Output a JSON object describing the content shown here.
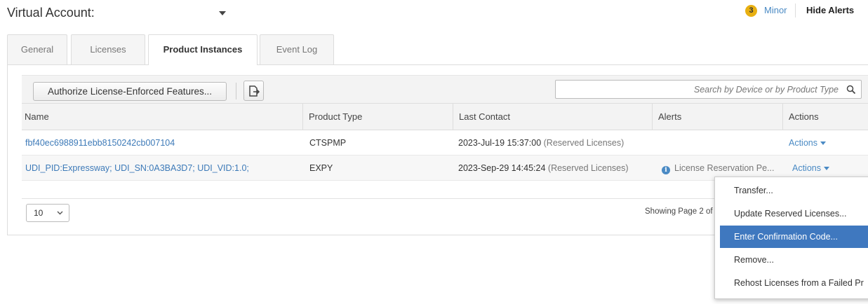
{
  "header": {
    "title": "Virtual Account:",
    "alert_count": "3",
    "alert_level": "Minor",
    "hide_alerts": "Hide Alerts"
  },
  "tabs": [
    {
      "label": "General",
      "active": false
    },
    {
      "label": "Licenses",
      "active": false
    },
    {
      "label": "Product Instances",
      "active": true
    },
    {
      "label": "Event Log",
      "active": false
    }
  ],
  "toolbar": {
    "authorize_label": "Authorize License-Enforced Features...",
    "export_icon": "export-icon",
    "search_placeholder": "Search by Device or by Product Type"
  },
  "table": {
    "columns": [
      "Name",
      "Product Type",
      "Last Contact",
      "Alerts",
      "Actions"
    ],
    "rows": [
      {
        "name": "fbf40ec6988911ebb8150242cb007104",
        "product_type": "CTSPMP",
        "last_contact": "2023-Jul-19 15:37:00",
        "last_contact_note": "(Reserved Licenses)",
        "alert": "",
        "actions": "Actions"
      },
      {
        "name": "UDI_PID:Expressway; UDI_SN:0A3BA3D7; UDI_VID:1.0;",
        "product_type": "EXPY",
        "last_contact": "2023-Sep-29 14:45:24",
        "last_contact_note": "(Reserved Licenses)",
        "alert": "License Reservation Pe...",
        "actions": "Actions"
      }
    ]
  },
  "pagination": {
    "page_size": "10",
    "showing": "Showing Page 2 of"
  },
  "actions_menu": {
    "items": [
      {
        "label": "Transfer...",
        "active": false
      },
      {
        "label": "Update Reserved Licenses...",
        "active": false
      },
      {
        "label": "Enter Confirmation Code...",
        "active": true
      },
      {
        "label": "Remove...",
        "active": false
      },
      {
        "label": "Rehost Licenses from a Failed Pr",
        "active": false
      }
    ]
  },
  "colors": {
    "link": "#3d7ab8",
    "alert_badge": "#e8b012",
    "menu_highlight": "#3f78bf"
  }
}
